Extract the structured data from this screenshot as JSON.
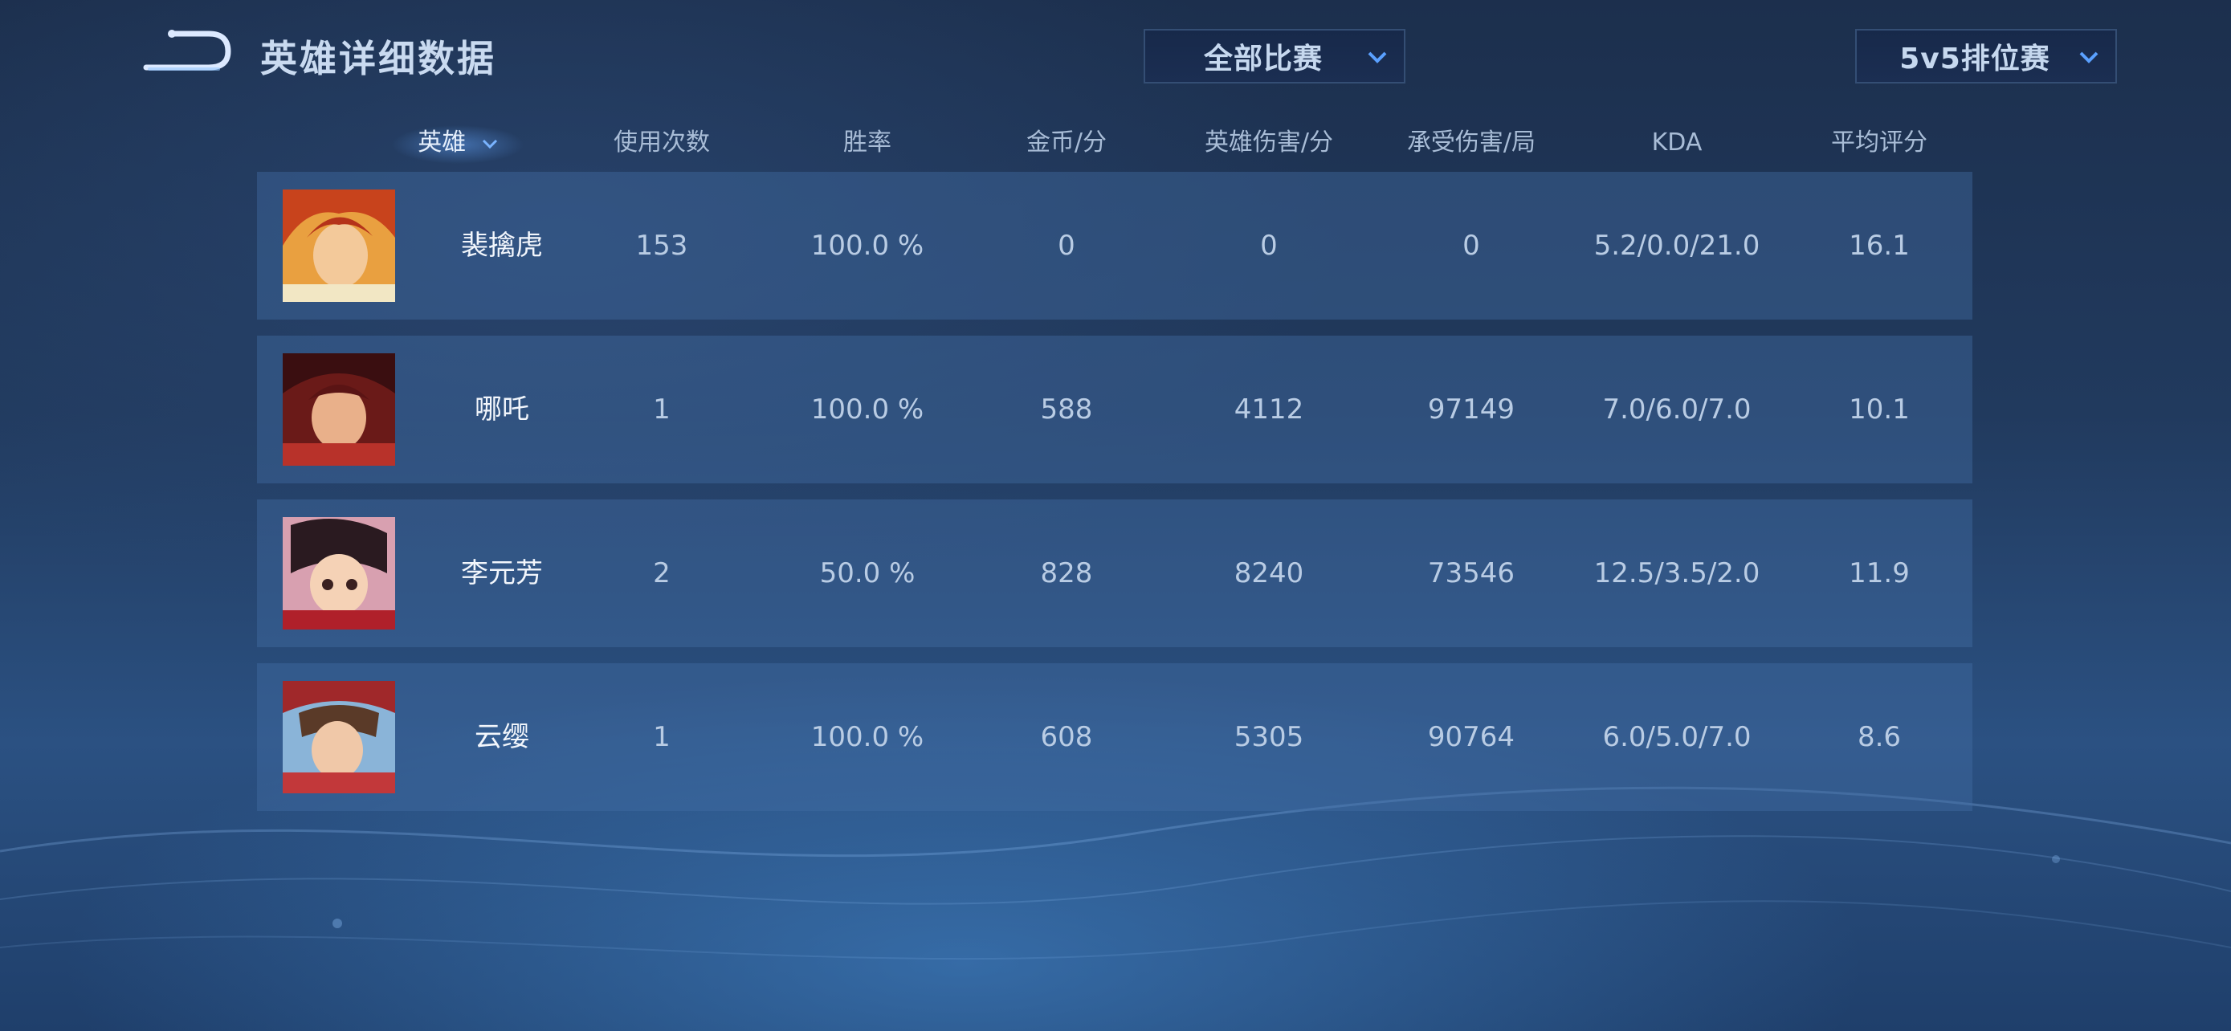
{
  "header": {
    "title": "英雄详细数据",
    "match_filter": "全部比赛",
    "mode_filter": "5v5排位赛"
  },
  "columns": {
    "hero": "英雄",
    "uses": "使用次数",
    "winrate": "胜率",
    "gold": "金币/分",
    "damage": "英雄伤害/分",
    "taken": "承受伤害/局",
    "kda": "KDA",
    "rating": "平均评分"
  },
  "rows": [
    {
      "name": "裴擒虎",
      "uses": "153",
      "winrate": "100.0 %",
      "gold": "0",
      "damage": "0",
      "taken": "0",
      "kda": "5.2/0.0/21.0",
      "rating": "16.1",
      "avatar_icon": "hero-portrait-icon"
    },
    {
      "name": "哪吒",
      "uses": "1",
      "winrate": "100.0 %",
      "gold": "588",
      "damage": "4112",
      "taken": "97149",
      "kda": "7.0/6.0/7.0",
      "rating": "10.1",
      "avatar_icon": "hero-portrait-icon"
    },
    {
      "name": "李元芳",
      "uses": "2",
      "winrate": "50.0 %",
      "gold": "828",
      "damage": "8240",
      "taken": "73546",
      "kda": "12.5/3.5/2.0",
      "rating": "11.9",
      "avatar_icon": "hero-portrait-icon"
    },
    {
      "name": "云缨",
      "uses": "1",
      "winrate": "100.0 %",
      "gold": "608",
      "damage": "5305",
      "taken": "90764",
      "kda": "6.0/5.0/7.0",
      "rating": "8.6",
      "avatar_icon": "hero-portrait-icon"
    }
  ],
  "colors": {
    "title": "#c9daf0",
    "row_bg": "#3d6596",
    "accent": "#5aa0ff"
  }
}
